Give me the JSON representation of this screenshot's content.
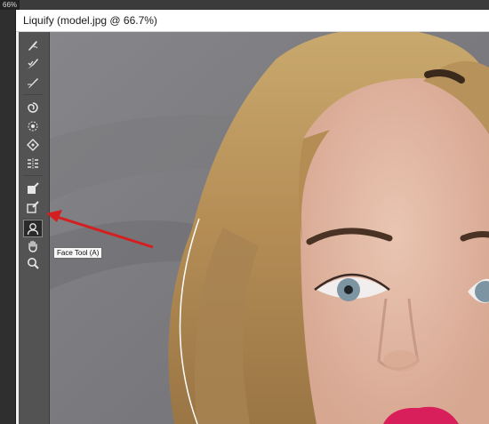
{
  "app": {
    "zoom_tag": "66%"
  },
  "window": {
    "title": "Liquify (model.jpg @ 66.7%)"
  },
  "tools": [
    {
      "name": "forward-warp-tool",
      "icon": "forward-warp-icon"
    },
    {
      "name": "reconstruct-tool",
      "icon": "reconstruct-icon"
    },
    {
      "name": "smooth-tool",
      "icon": "smooth-icon"
    },
    {
      "name": "twirl-clockwise-tool",
      "icon": "twirl-icon"
    },
    {
      "name": "pucker-tool",
      "icon": "pucker-icon"
    },
    {
      "name": "bloat-tool",
      "icon": "bloat-icon"
    },
    {
      "name": "push-left-tool",
      "icon": "push-left-icon"
    },
    {
      "name": "freeze-mask-tool",
      "icon": "freeze-mask-icon"
    },
    {
      "name": "thaw-mask-tool",
      "icon": "thaw-mask-icon"
    },
    {
      "name": "face-tool",
      "icon": "face-icon",
      "active": true
    },
    {
      "name": "hand-tool",
      "icon": "hand-icon"
    },
    {
      "name": "zoom-tool",
      "icon": "zoom-icon"
    }
  ],
  "tooltip": {
    "text": "Face Tool (A)"
  },
  "colors": {
    "toolbar": "#535353",
    "annotation_arrow": "#d31f1f",
    "lip": "#d81e5b"
  }
}
